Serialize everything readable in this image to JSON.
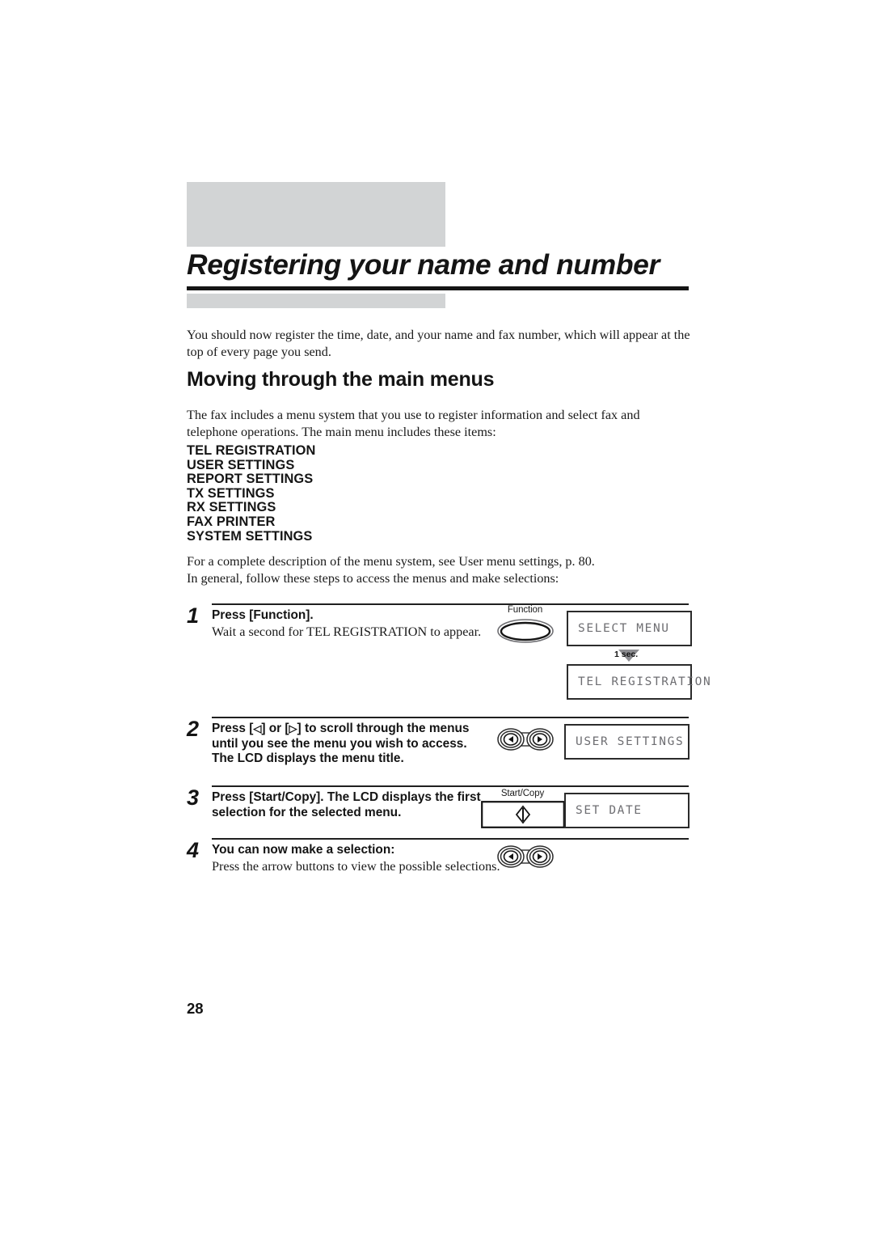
{
  "document": {
    "page_number": "28",
    "title": "Registering your name and number",
    "intro_paragraph": "You should now register the time, date, and your name and fax number, which will appear at the top of every page you send.",
    "section_heading": "Moving through the main menus",
    "section_paragraph": "The fax includes a menu system that you use to register information and select fax and telephone operations. The main menu includes these items:",
    "menu_items": [
      "TEL REGISTRATION",
      "USER SETTINGS",
      "REPORT SETTINGS",
      "TX SETTINGS",
      "RX SETTINGS",
      "FAX PRINTER",
      "SYSTEM SETTINGS"
    ],
    "after_menu_paragraph_line1": "For a complete description of the menu system, see User menu settings, p. 80.",
    "after_menu_paragraph_line2": "In general, follow these steps to access the menus and make selections:"
  },
  "steps": [
    {
      "number": "1",
      "bold_text": "Press [Function].",
      "plain_text": "Wait a second for TEL REGISTRATION to appear.",
      "button_label": "Function",
      "button_icon": "oval-button-icon",
      "lcd_primary": "SELECT MENU",
      "transition_label": "1 sec.",
      "lcd_secondary": "TEL REGISTRATION"
    },
    {
      "number": "2",
      "bold_text_pre": "Press [",
      "bold_arrow_left": "◁",
      "bold_text_mid": "] or [",
      "bold_arrow_right": "▷",
      "bold_text_post": "] to scroll through the menus until you see the menu you wish to access. The LCD displays the menu title.",
      "button_icon": "arrow-rocker-button-icon",
      "lcd_primary": "USER SETTINGS"
    },
    {
      "number": "3",
      "bold_text": "Press [Start/Copy]. The LCD displays the first selection for the selected menu.",
      "button_label": "Start/Copy",
      "button_icon": "start-copy-button-icon",
      "lcd_primary": "SET DATE"
    },
    {
      "number": "4",
      "bold_text": "You can now make a selection:",
      "plain_text": "Press the arrow buttons to view the possible selections.",
      "button_icon": "arrow-rocker-button-icon"
    }
  ],
  "colors": {
    "header_gray": "#d2d4d5",
    "rule_black": "#151515",
    "lcd_text": "#6e6e72",
    "body_text": "#1a1a1a"
  }
}
